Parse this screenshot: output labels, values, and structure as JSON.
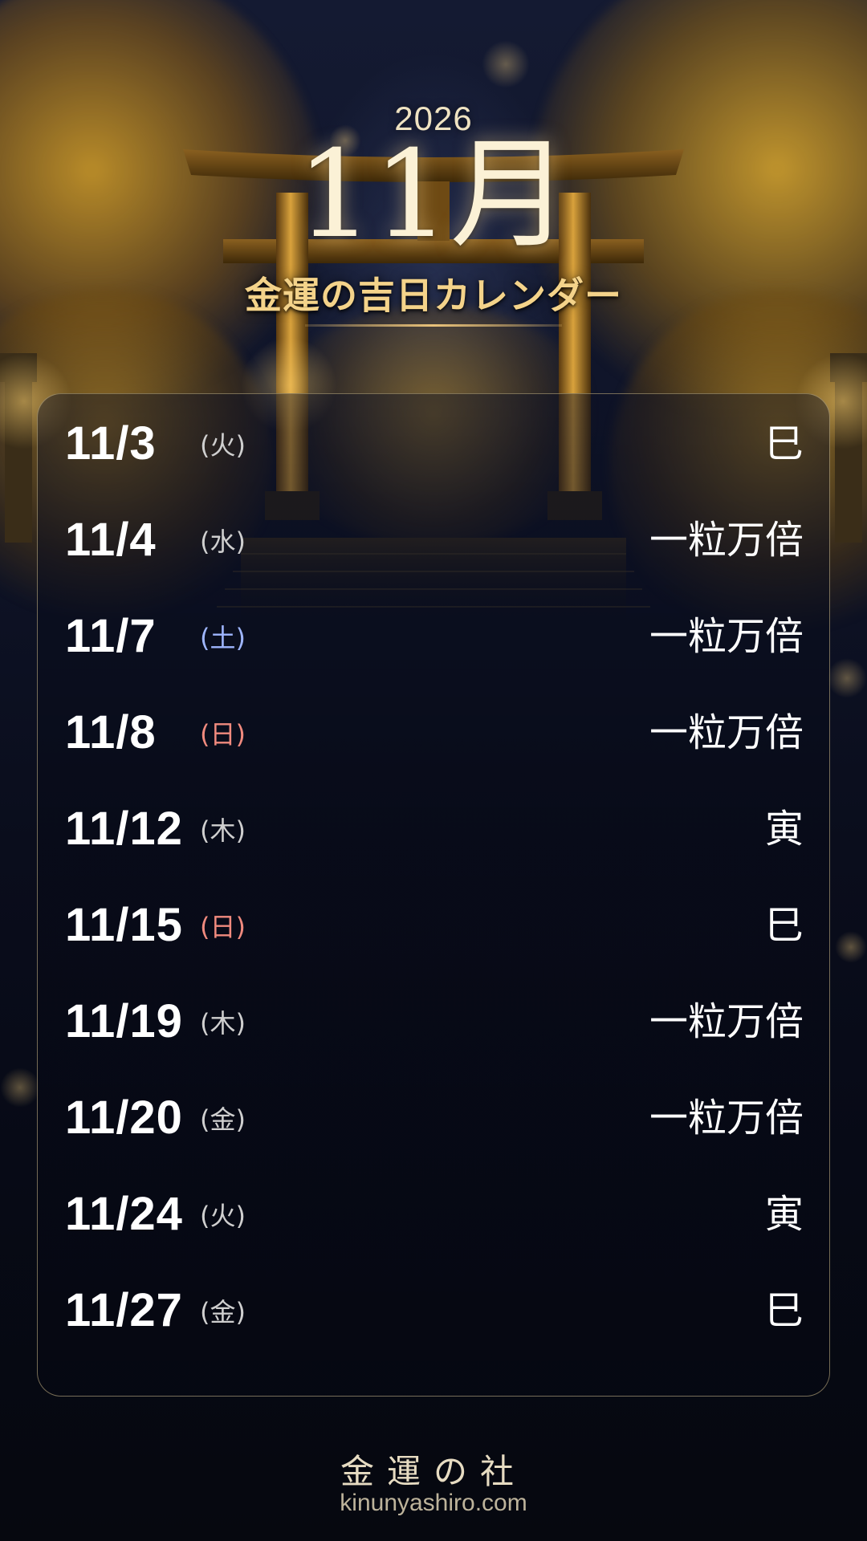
{
  "header": {
    "year": "2026",
    "month": "11月",
    "subtitle": "金運の吉日カレンダー"
  },
  "calendar": {
    "entries": [
      {
        "date": "11/3",
        "weekday": "(火)",
        "weekday_type": "weekday",
        "label": "巳"
      },
      {
        "date": "11/4",
        "weekday": "(水)",
        "weekday_type": "weekday",
        "label": "一粒万倍"
      },
      {
        "date": "11/7",
        "weekday": "(土)",
        "weekday_type": "saturday",
        "label": "一粒万倍"
      },
      {
        "date": "11/8",
        "weekday": "(日)",
        "weekday_type": "sunday",
        "label": "一粒万倍"
      },
      {
        "date": "11/12",
        "weekday": "(木)",
        "weekday_type": "weekday",
        "label": "寅"
      },
      {
        "date": "11/15",
        "weekday": "(日)",
        "weekday_type": "sunday",
        "label": "巳"
      },
      {
        "date": "11/19",
        "weekday": "(木)",
        "weekday_type": "weekday",
        "label": "一粒万倍"
      },
      {
        "date": "11/20",
        "weekday": "(金)",
        "weekday_type": "weekday",
        "label": "一粒万倍"
      },
      {
        "date": "11/24",
        "weekday": "(火)",
        "weekday_type": "weekday",
        "label": "寅"
      },
      {
        "date": "11/27",
        "weekday": "(金)",
        "weekday_type": "weekday",
        "label": "巳"
      }
    ]
  },
  "footer": {
    "brand": "金運の社",
    "url": "kinunyashiro.com"
  },
  "colors": {
    "gold_accent": "#f4d38a",
    "saturday": "#9fb6ff",
    "sunday": "#f08a7e",
    "weekday": "#cfcfcf"
  }
}
